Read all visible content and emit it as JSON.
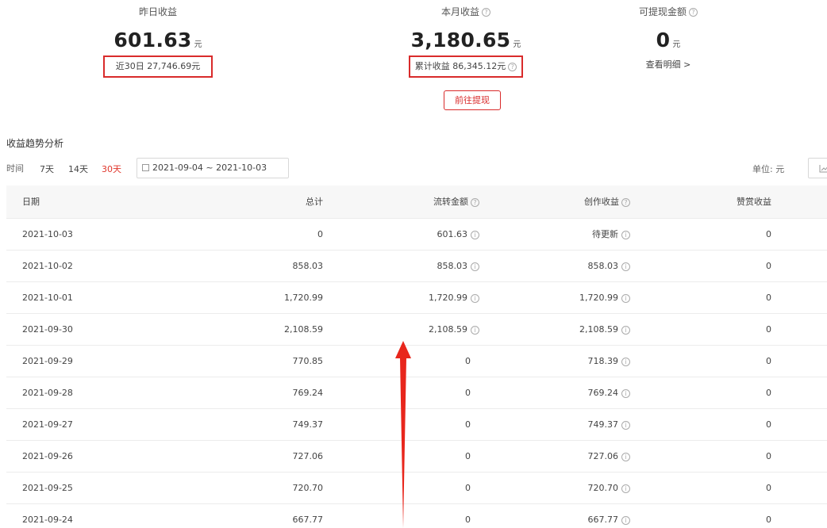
{
  "stats": {
    "yesterday": {
      "label": "昨日收益",
      "value": "601.63",
      "unit": "元",
      "sub": "近30日 27,746.69元"
    },
    "month": {
      "label": "本月收益",
      "value": "3,180.65",
      "unit": "元",
      "sub": "累计收益 86,345.12元"
    },
    "withdrawable": {
      "label": "可提现金额",
      "value": "0",
      "unit": "元",
      "link": "查看明细 >"
    }
  },
  "withdraw_button": "前往提现",
  "section": {
    "title": "收益趋势分析",
    "filter_label": "时间",
    "ranges": [
      "7天",
      "14天",
      "30天"
    ],
    "active_range": "30天",
    "date_range": "2021-09-04 ~ 2021-10-03",
    "unit_label": "单位: 元"
  },
  "table": {
    "headers": {
      "date": "日期",
      "total": "总计",
      "flow": "流转金额",
      "create": "创作收益",
      "reward": "赞赏收益"
    },
    "rows": [
      {
        "date": "2021-10-03",
        "total": "0",
        "flow": "601.63",
        "create": "待更新",
        "reward": "0"
      },
      {
        "date": "2021-10-02",
        "total": "858.03",
        "flow": "858.03",
        "create": "858.03",
        "reward": "0"
      },
      {
        "date": "2021-10-01",
        "total": "1,720.99",
        "flow": "1,720.99",
        "create": "1,720.99",
        "reward": "0"
      },
      {
        "date": "2021-09-30",
        "total": "2,108.59",
        "flow": "2,108.59",
        "create": "2,108.59",
        "reward": "0"
      },
      {
        "date": "2021-09-29",
        "total": "770.85",
        "flow": "0",
        "create": "718.39",
        "reward": "0"
      },
      {
        "date": "2021-09-28",
        "total": "769.24",
        "flow": "0",
        "create": "769.24",
        "reward": "0"
      },
      {
        "date": "2021-09-27",
        "total": "749.37",
        "flow": "0",
        "create": "749.37",
        "reward": "0"
      },
      {
        "date": "2021-09-26",
        "total": "727.06",
        "flow": "0",
        "create": "727.06",
        "reward": "0"
      },
      {
        "date": "2021-09-25",
        "total": "720.70",
        "flow": "0",
        "create": "720.70",
        "reward": "0"
      },
      {
        "date": "2021-09-24",
        "total": "667.77",
        "flow": "0",
        "create": "667.77",
        "reward": "0"
      }
    ]
  },
  "colors": {
    "accent": "#e0362c",
    "highlight_box": "#d92b2b",
    "arrow": "#e8261c"
  }
}
